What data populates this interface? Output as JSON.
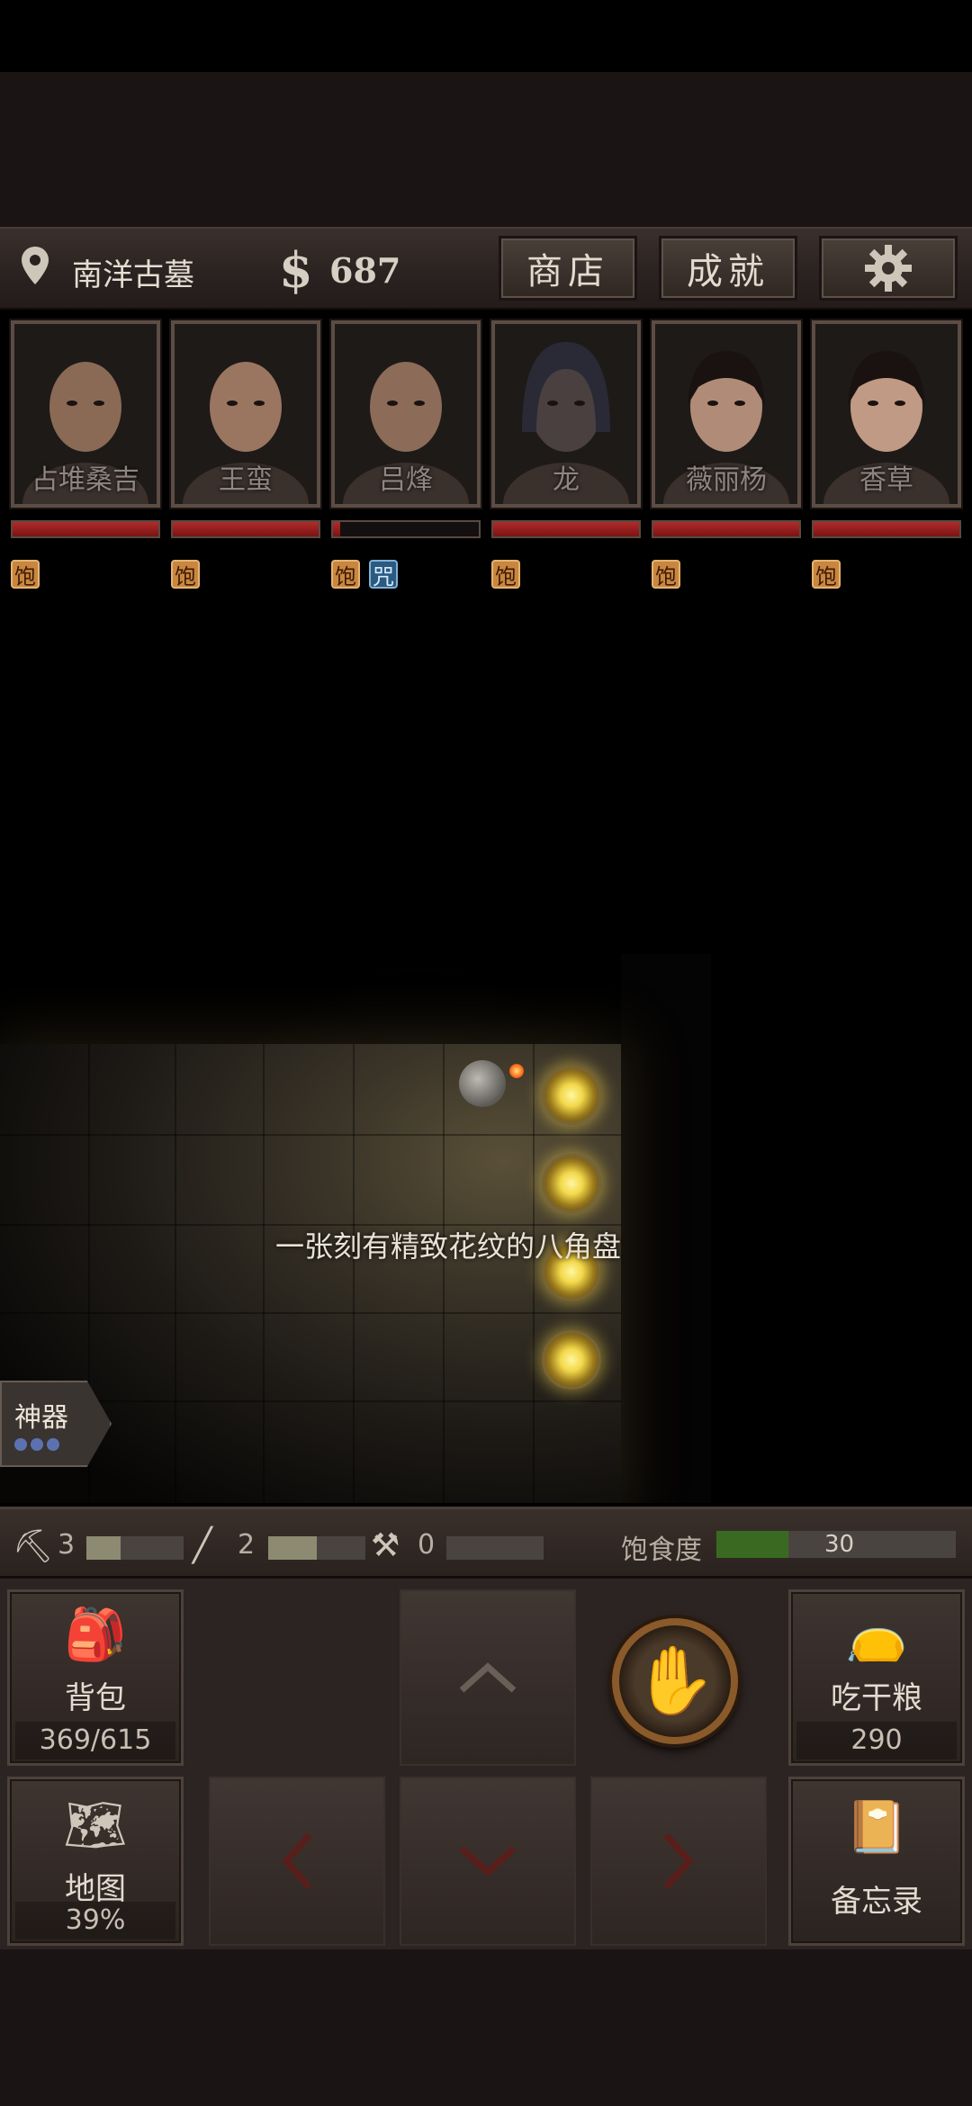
{
  "header": {
    "location": "南洋古墓",
    "money_symbol": "$",
    "money": "687",
    "shop_label": "商店",
    "achievements_label": "成就"
  },
  "characters": [
    {
      "name": "占堆桑吉",
      "hp": 1.0,
      "statuses": [
        "饱"
      ]
    },
    {
      "name": "王蛮",
      "hp": 1.0,
      "statuses": [
        "饱"
      ]
    },
    {
      "name": "吕烽",
      "hp": 0.05,
      "statuses": [
        "饱",
        "咒"
      ]
    },
    {
      "name": "龙",
      "hp": 1.0,
      "statuses": [
        "饱"
      ]
    },
    {
      "name": "薇丽杨",
      "hp": 1.0,
      "statuses": [
        "饱"
      ]
    },
    {
      "name": "香草",
      "hp": 1.0,
      "statuses": [
        "饱"
      ]
    }
  ],
  "game": {
    "item_description": "一张刻有精致花纹的八角盘",
    "artifact_label": "神器"
  },
  "tools": {
    "pickaxe": {
      "count": "3",
      "level": 0.35
    },
    "rope": {
      "count": "2",
      "level": 0.5
    },
    "shovel": {
      "count": "0",
      "level": 0
    }
  },
  "satiety": {
    "label": "饱食度",
    "value": "30",
    "level": 0.3
  },
  "controls": {
    "backpack_label": "背包",
    "backpack_capacity": "369/615",
    "map_label": "地图",
    "map_progress": "39%",
    "eat_label": "吃干粮",
    "eat_count": "290",
    "memo_label": "备忘录"
  },
  "colors": {
    "hp_red": "#b02a2a",
    "satiety_green": "#3a6a22",
    "hand_orange": "#e0a870"
  },
  "icons": {
    "location": "map-pin-icon",
    "settings": "gear-icon",
    "hand": "hand-icon"
  }
}
